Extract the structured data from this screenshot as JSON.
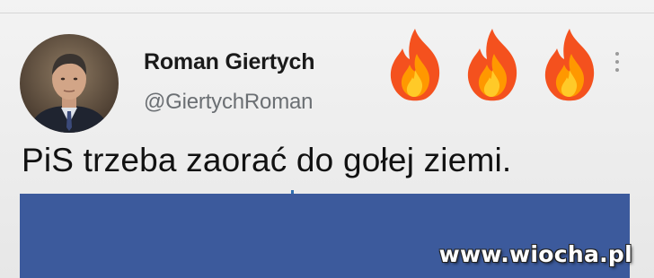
{
  "author": {
    "name": "Roman Giertych",
    "handle": "@GiertychRoman"
  },
  "tweet": {
    "text": "PiS trzeba zaorać do gołej ziemi."
  },
  "reactions": {
    "icons": [
      "fire-icon",
      "fire-icon",
      "fire-icon"
    ]
  },
  "menu": {
    "icon": "more-options-icon"
  },
  "watermark": {
    "text": "www.wiocha.pl"
  },
  "colors": {
    "media_block": "#3c5a9c",
    "handle": "#6b6f73",
    "fire_outer": "#f4511e",
    "fire_inner": "#ffca28"
  }
}
